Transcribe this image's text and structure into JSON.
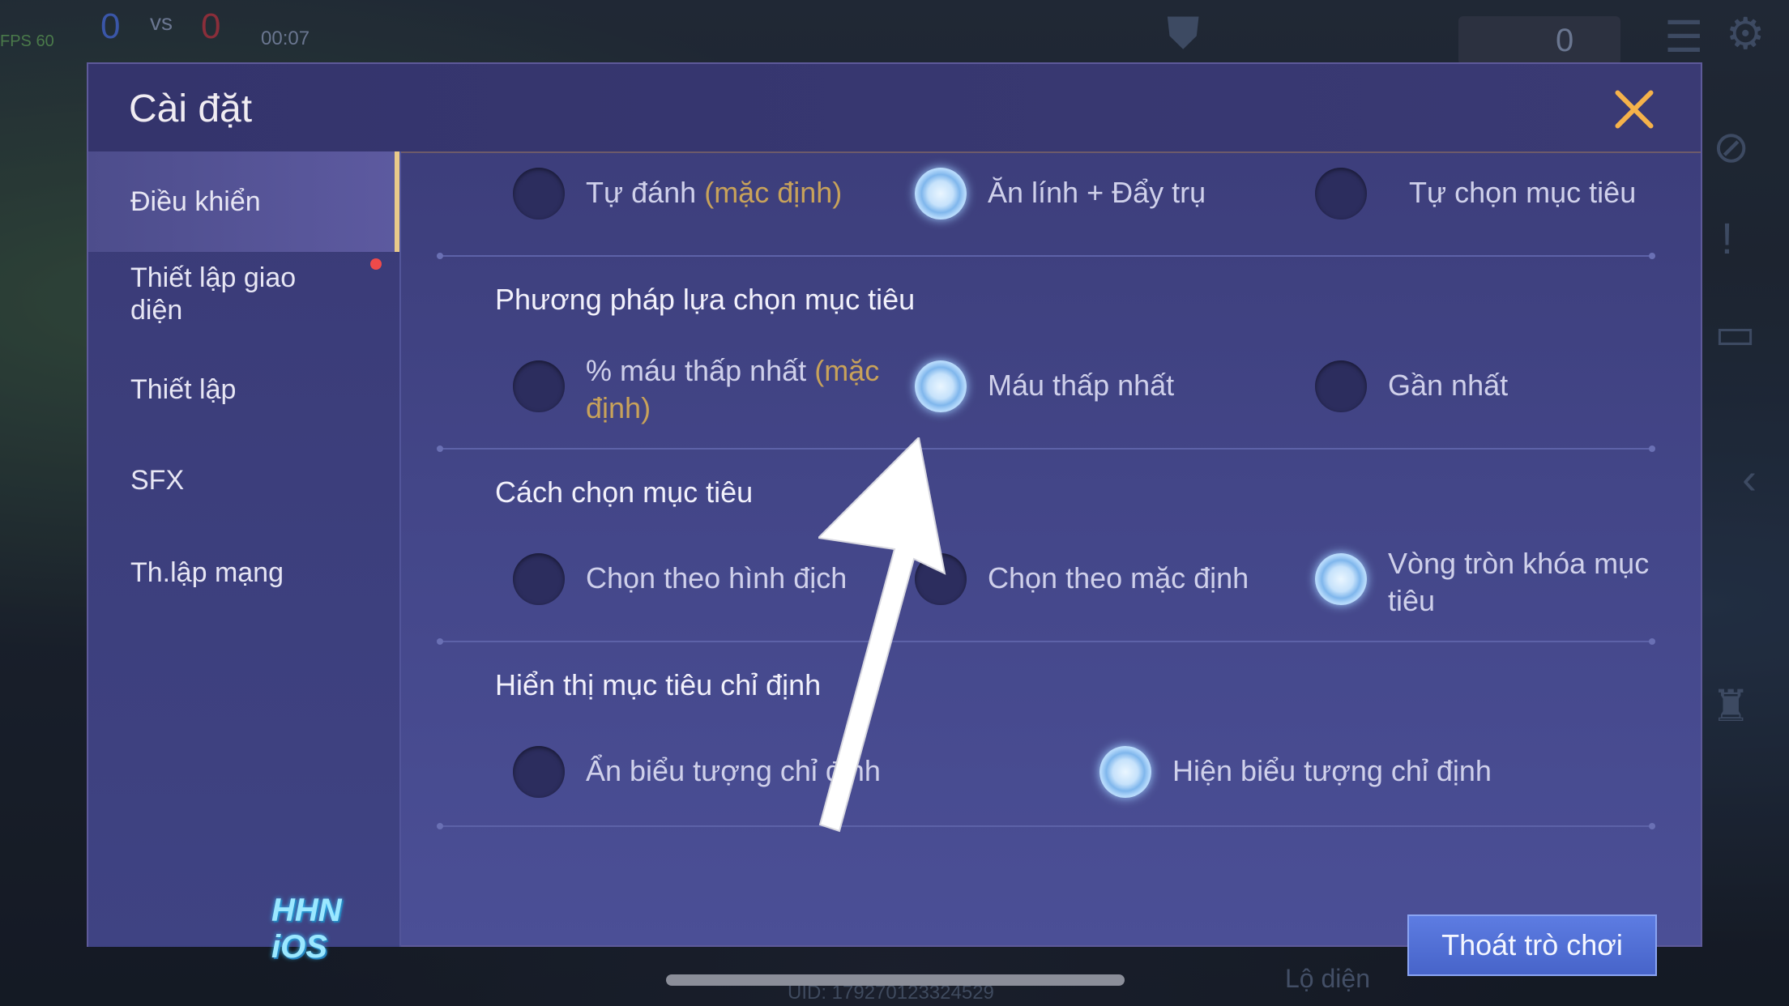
{
  "hud": {
    "score_left": "0",
    "vs": "vs",
    "score_right": "0",
    "time": "00:07",
    "fps": "FPS 60",
    "cart_count": "0",
    "uid": "UID: 179270123324529",
    "lo_dien": "Lộ diện"
  },
  "dialog": {
    "title": "Cài đặt"
  },
  "sidebar": {
    "items": [
      {
        "label": "Điều khiển",
        "active": true
      },
      {
        "label": "Thiết lập giao diện",
        "badge": "red-dot"
      },
      {
        "label": "Thiết lập"
      },
      {
        "label": "SFX"
      },
      {
        "label": "Th.lập mạng"
      }
    ]
  },
  "watermark": "HHN iOS",
  "sections": {
    "attack": {
      "options": [
        {
          "label": "Tự đánh",
          "suffix": "(mặc định)",
          "selected": false
        },
        {
          "label": "Ăn lính + Đẩy trụ",
          "selected": true
        },
        {
          "label": "Tự chọn mục tiêu",
          "selected": false
        }
      ]
    },
    "target_method": {
      "title": "Phương pháp lựa chọn mục tiêu",
      "options": [
        {
          "label": "% máu thấp nhất",
          "suffix": "(mặc định)",
          "selected": false
        },
        {
          "label": "Máu thấp nhất",
          "selected": true
        },
        {
          "label": "Gần nhất",
          "selected": false
        }
      ]
    },
    "target_select": {
      "title": "Cách chọn mục tiêu",
      "options": [
        {
          "label": "Chọn theo hình địch",
          "selected": false
        },
        {
          "label": "Chọn theo mặc định",
          "selected": false
        },
        {
          "label": "Vòng tròn khóa mục tiêu",
          "selected": true
        }
      ]
    },
    "target_display": {
      "title": "Hiển thị mục tiêu chỉ định",
      "options": [
        {
          "label": "Ẩn biểu tượng chỉ định",
          "selected": false
        },
        {
          "label": "Hiện biểu tượng chỉ định",
          "selected": true
        }
      ]
    }
  },
  "exit_button": "Thoát trò chơi",
  "colors": {
    "accent_gold": "#c8a25a",
    "close_icon": "#f5b24a",
    "button_blue": "#4764c9",
    "dialog_bg": "#3b3c78"
  }
}
